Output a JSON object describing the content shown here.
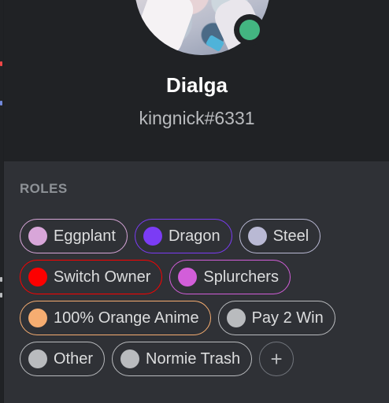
{
  "profile": {
    "display_name": "Dialga",
    "tag": "kingnick#6331",
    "status": "online",
    "status_color": "#43b581",
    "avatar_icon": "anime-avatar"
  },
  "roles": {
    "title": "ROLES",
    "add_label": "+",
    "rows": [
      [
        {
          "name": "Eggplant",
          "color": "#d8a6d9"
        },
        {
          "name": "Dragon",
          "color": "#7b3cf5"
        },
        {
          "name": "Steel",
          "color": "#b9b9d4"
        }
      ],
      [
        {
          "name": "Switch Owner",
          "color": "#fd0000"
        },
        {
          "name": "Splurchers",
          "color": "#d25ed9"
        }
      ],
      [
        {
          "name": "100% Orange Anime",
          "color": "#f6ad71"
        },
        {
          "name": "Pay 2 Win",
          "color": "#b9bbbe"
        }
      ],
      [
        {
          "name": "Other",
          "color": "#b9bbbe"
        },
        {
          "name": "Normie Trash",
          "color": "#b9bbbe"
        }
      ]
    ]
  }
}
